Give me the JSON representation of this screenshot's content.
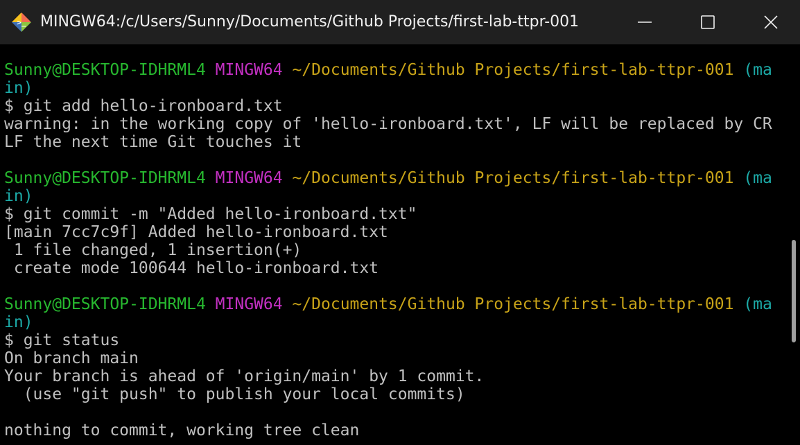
{
  "window": {
    "title": "MINGW64:/c/Users/Sunny/Documents/Github Projects/first-lab-ttpr-001",
    "icon": "git-bash-icon"
  },
  "prompt": {
    "user_host": "Sunny@DESKTOP-IDHRML4",
    "env": "MINGW64",
    "path": "~/Documents/Github Projects/first-lab-ttpr-001",
    "branch_part1": "(ma",
    "branch_part2": "in)"
  },
  "blocks": [
    {
      "command": "$ git add hello-ironboard.txt",
      "output": [
        "warning: in the working copy of 'hello-ironboard.txt', LF will be replaced by CR",
        "LF the next time Git touches it"
      ]
    },
    {
      "command": "$ git commit -m \"Added hello-ironboard.txt\"",
      "output": [
        "[main 7cc7c9f] Added hello-ironboard.txt",
        " 1 file changed, 1 insertion(+)",
        " create mode 100644 hello-ironboard.txt"
      ]
    },
    {
      "command": "$ git status",
      "output": [
        "On branch main",
        "Your branch is ahead of 'origin/main' by 1 commit.",
        "  (use \"git push\" to publish your local commits)",
        "",
        "nothing to commit, working tree clean"
      ]
    }
  ],
  "colors": {
    "user_host": "#27b82f",
    "env": "#c330c2",
    "path": "#c8a318",
    "branch": "#1caaa7",
    "text": "#c0c0c0",
    "background": "#000000",
    "titlebar": "#202020"
  }
}
